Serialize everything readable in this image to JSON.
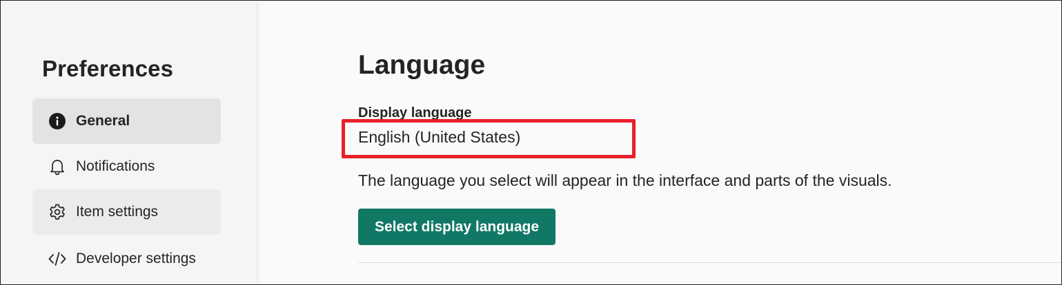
{
  "sidebar": {
    "title": "Preferences",
    "items": [
      {
        "label": "General",
        "icon": "info-icon",
        "selected": true
      },
      {
        "label": "Notifications",
        "icon": "bell-icon",
        "selected": false
      },
      {
        "label": "Item settings",
        "icon": "gear-icon",
        "selected": false
      },
      {
        "label": "Developer settings",
        "icon": "code-icon",
        "selected": false
      }
    ]
  },
  "main": {
    "section_title": "Language",
    "display_language": {
      "label": "Display language",
      "value": "English (United States)"
    },
    "description": "The language you select will appear in the interface and parts of the visuals.",
    "button_label": "Select display language"
  },
  "colors": {
    "accent": "#117865",
    "highlight": "#e8202a",
    "sidebar_bg": "#f5f5f5",
    "selected_bg": "#e3e3e3"
  }
}
